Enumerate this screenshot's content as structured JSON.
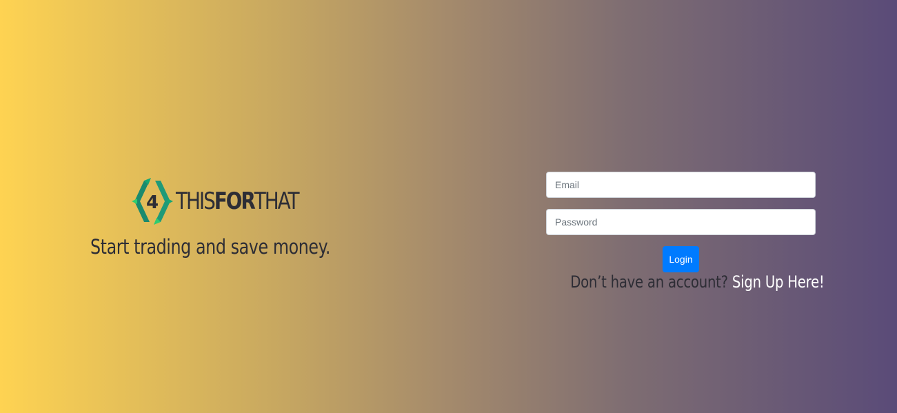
{
  "brand": {
    "logo_glyph": "4",
    "name_part1": "THIS",
    "name_part2": "FOR",
    "name_part3": "THAT",
    "colors": {
      "logo_teal": "#1a8a6e",
      "logo_green": "#2ecc71",
      "text_dark": "#2d2d35"
    }
  },
  "tagline": "Start trading and save money.",
  "login_form": {
    "email_placeholder": "Email",
    "password_placeholder": "Password",
    "login_label": "Login",
    "button_color": "#007bff"
  },
  "signup": {
    "prompt": "Don’t have an account?",
    "link_label": "Sign Up Here!"
  },
  "background": {
    "gradient_start": "#fed352",
    "gradient_end": "#5a4b78"
  }
}
